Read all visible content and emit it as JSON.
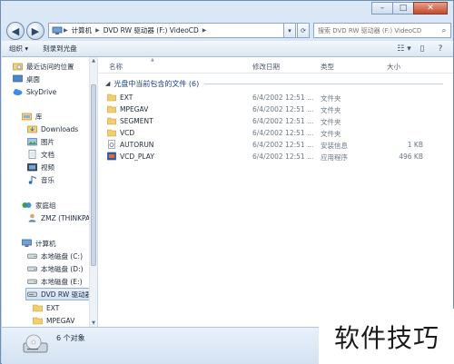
{
  "window": {
    "controls": {
      "minimize": "–",
      "maximize": "□",
      "close": "✕"
    }
  },
  "address_bar": {
    "segments": [
      "计算机",
      "DVD RW 驱动器 (F:) VideoCD"
    ],
    "history_arrow": "▾",
    "refresh": "⟳"
  },
  "search": {
    "placeholder": "搜索 DVD RW 驱动器 (F:) VideoCD"
  },
  "toolbar": {
    "organize_label": "组织 ▾",
    "burn_label": "刻录到光盘"
  },
  "nav_pane": {
    "favorites": [
      {
        "label": "最近访问的位置",
        "icon": "recent-places-icon"
      },
      {
        "label": "桌面",
        "icon": "desktop-icon"
      },
      {
        "label": "SkyDrive",
        "icon": "skydrive-icon"
      }
    ],
    "libraries_header": "库",
    "libraries": [
      {
        "label": "Downloads",
        "icon": "downloads-icon"
      },
      {
        "label": "图片",
        "icon": "pictures-icon"
      },
      {
        "label": "文档",
        "icon": "documents-icon"
      },
      {
        "label": "视频",
        "icon": "videos-icon"
      },
      {
        "label": "音乐",
        "icon": "music-icon"
      }
    ],
    "homegroup_header": "家庭组",
    "homegroup": [
      {
        "label": "ZMZ (THINKPAD",
        "icon": "user-icon"
      }
    ],
    "computer_header": "计算机",
    "computer": [
      {
        "label": "本地磁盘 (C:)",
        "icon": "drive-icon",
        "selected": false
      },
      {
        "label": "本地磁盘 (D:)",
        "icon": "drive-icon",
        "selected": false
      },
      {
        "label": "本地磁盘 (E:)",
        "icon": "drive-icon",
        "selected": false
      },
      {
        "label": "DVD RW 驱动器",
        "icon": "dvd-drive-icon",
        "selected": true
      }
    ],
    "dvd_children": [
      {
        "label": "EXT",
        "icon": "folder-icon"
      },
      {
        "label": "MPEGAV",
        "icon": "folder-icon"
      }
    ]
  },
  "columns": {
    "name": "名称",
    "modified": "修改日期",
    "type": "类型",
    "size": "大小"
  },
  "group": {
    "label": "光盘中当前包含的文件 (6)"
  },
  "files": [
    {
      "name": "EXT",
      "modified": "6/4/2002 12:51 ...",
      "type": "文件夹",
      "size": "",
      "icon": "folder-icon"
    },
    {
      "name": "MPEGAV",
      "modified": "6/4/2002 12:51 ...",
      "type": "文件夹",
      "size": "",
      "icon": "folder-icon"
    },
    {
      "name": "SEGMENT",
      "modified": "6/4/2002 12:51 ...",
      "type": "文件夹",
      "size": "",
      "icon": "folder-icon"
    },
    {
      "name": "VCD",
      "modified": "6/4/2002 12:51 ...",
      "type": "文件夹",
      "size": "",
      "icon": "folder-icon"
    },
    {
      "name": "AUTORUN",
      "modified": "6/4/2002 12:51 ...",
      "type": "安装信息",
      "size": "1 KB",
      "icon": "settings-file-icon"
    },
    {
      "name": "VCD_PLAY",
      "modified": "6/4/2002 12:51 ...",
      "type": "应用程序",
      "size": "496 KB",
      "icon": "application-icon"
    }
  ],
  "status": {
    "count": "6 个对象"
  },
  "watermark": "软件技巧"
}
